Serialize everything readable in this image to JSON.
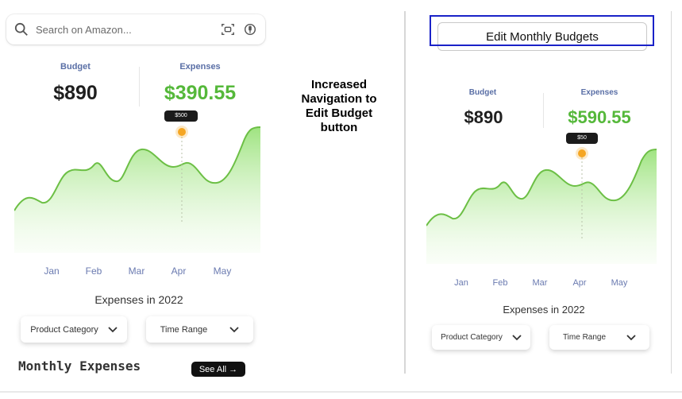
{
  "left_panel": {
    "search": {
      "placeholder": "Search on Amazon...",
      "icons": [
        "search-icon",
        "camera-scan-icon",
        "microphone-icon"
      ]
    },
    "budget_label": "Budget",
    "budget_value": "$890",
    "expenses_label": "Expenses",
    "expenses_value": "$390.55",
    "expenses_color": "#55b83a",
    "tooltip": "$500",
    "months": [
      "Jan",
      "Feb",
      "Mar",
      "Apr",
      "May"
    ],
    "caption": "Expenses in 2022",
    "dropdowns": [
      "Product Category",
      "Time Range"
    ],
    "section_title": "Monthly Expenses",
    "see_all": "See All →"
  },
  "annotation": {
    "line1": "Increased",
    "line2": "Navigation to",
    "line3": "Edit Budget",
    "line4": "button"
  },
  "right_panel": {
    "edit_button": "Edit Monthly Budgets",
    "highlight_color": "#1a22c8",
    "budget_label": "Budget",
    "budget_value": "$890",
    "expenses_label": "Expenses",
    "expenses_value": "$590.55",
    "expenses_color": "#55b83a",
    "tooltip": "$50",
    "months": [
      "Jan",
      "Feb",
      "Mar",
      "Apr",
      "May"
    ],
    "caption": "Expenses in 2022",
    "dropdowns": [
      "Product Category",
      "Time Range"
    ]
  },
  "colors": {
    "accent_green": "#7ccf4f",
    "tooltip_dot": "#f5a623",
    "month_label": "#6a7ab0"
  }
}
